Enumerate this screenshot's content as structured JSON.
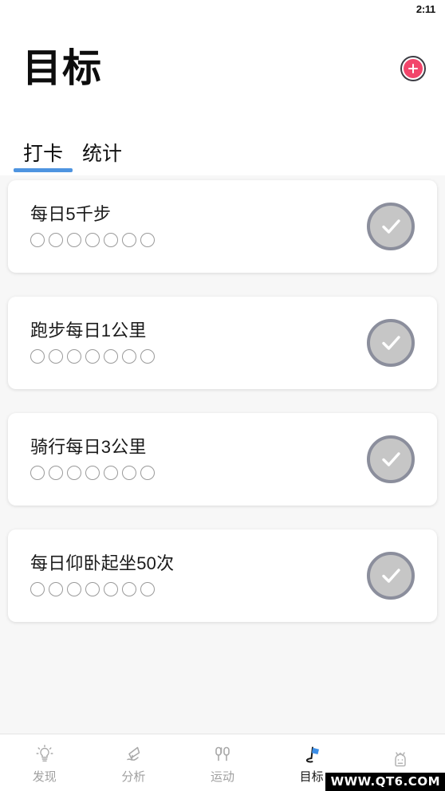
{
  "status_bar": {
    "time": "2:11"
  },
  "header": {
    "title": "目标",
    "add_button_label": "+",
    "add_button_color": "#f2456b"
  },
  "tabs": {
    "active_index": 0,
    "accent_color": "#4e94e0",
    "items": [
      {
        "label": "打卡"
      },
      {
        "label": "统计"
      }
    ]
  },
  "goals": [
    {
      "title": "每日5千步",
      "dots_total": 7,
      "dots_filled": 0,
      "check_state": "unchecked"
    },
    {
      "title": "跑步每日1公里",
      "dots_total": 7,
      "dots_filled": 0,
      "check_state": "unchecked"
    },
    {
      "title": "骑行每日3公里",
      "dots_total": 7,
      "dots_filled": 0,
      "check_state": "unchecked"
    },
    {
      "title": "每日仰卧起坐50次",
      "dots_total": 7,
      "dots_filled": 0,
      "check_state": "unchecked"
    }
  ],
  "bottom_nav": {
    "active_index": 3,
    "items": [
      {
        "label": "发现",
        "icon": "lightbulb-icon"
      },
      {
        "label": "分析",
        "icon": "pen-chart-icon"
      },
      {
        "label": "运动",
        "icon": "earbuds-icon"
      },
      {
        "label": "目标",
        "icon": "flag-icon"
      },
      {
        "label": "",
        "icon": "robot-icon"
      }
    ]
  },
  "watermark": {
    "text": "WWW.QT6.COM"
  }
}
